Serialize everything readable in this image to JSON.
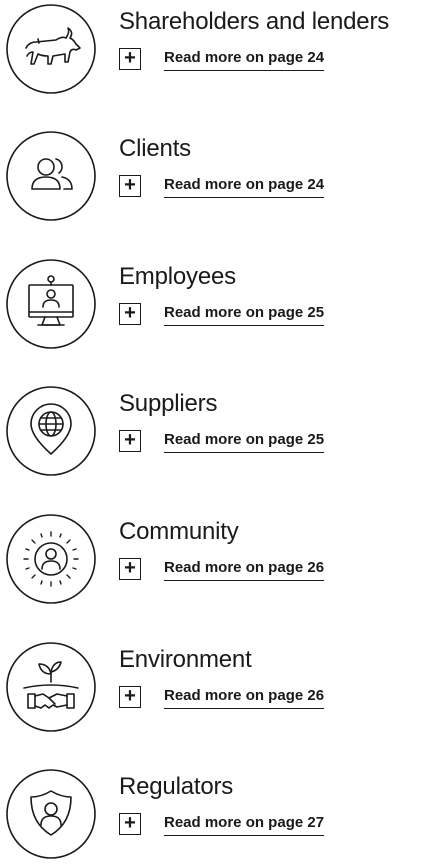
{
  "stakeholders": [
    {
      "title": "Shareholders and lenders",
      "link": "Read more on page 24",
      "icon": "bull-icon"
    },
    {
      "title": "Clients",
      "link": "Read more on page 24",
      "icon": "people-icon"
    },
    {
      "title": "Employees",
      "link": "Read more on page 25",
      "icon": "monitor-person-icon"
    },
    {
      "title": "Suppliers",
      "link": "Read more on page 25",
      "icon": "globe-pin-icon"
    },
    {
      "title": "Community",
      "link": "Read more on page 26",
      "icon": "person-radiating-icon"
    },
    {
      "title": "Environment",
      "link": "Read more on page 26",
      "icon": "plant-handshake-icon"
    },
    {
      "title": "Regulators",
      "link": "Read more on page 27",
      "icon": "shield-person-icon"
    }
  ],
  "plus_symbol": "+"
}
